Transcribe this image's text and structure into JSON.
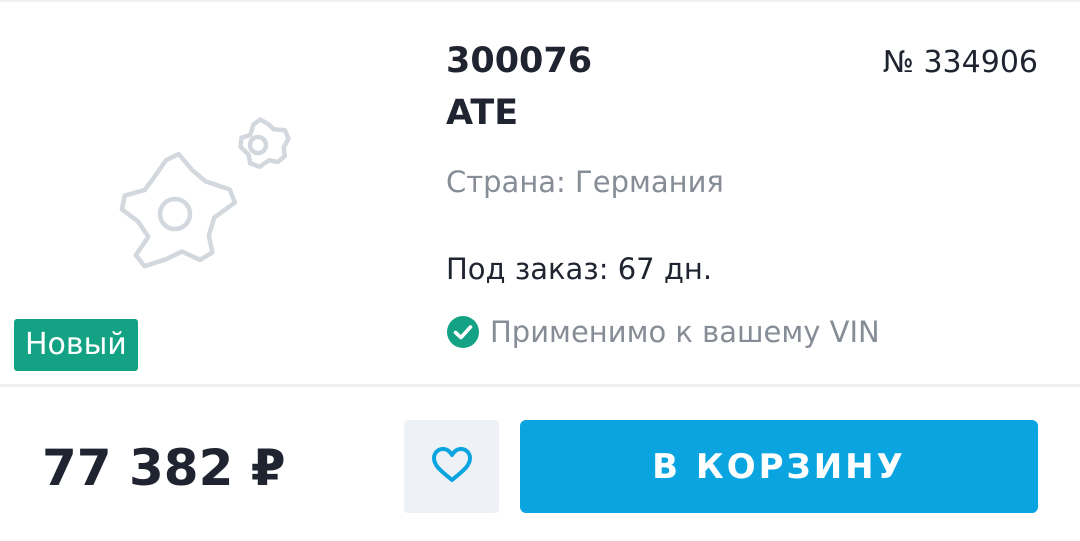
{
  "product": {
    "article": "300076",
    "brand": "ATE",
    "number": "№ 334906",
    "country": "Страна: Германия",
    "availability": "Под заказ: 67 дн.",
    "vin_match": "Применимо к вашему VIN",
    "badge": "Новый",
    "image_icon": "gears-placeholder-icon"
  },
  "footer": {
    "price": "77 382 ₽",
    "favorite_icon": "heart-icon",
    "cart_label": "В КОРЗИНУ"
  },
  "colors": {
    "badge": "#13a284",
    "check": "#13a284",
    "cart_button": "#0aa5e0",
    "favorite_bg": "#eef1f6",
    "favorite_icon": "#0aa5e0",
    "placeholder_icon": "#d3d8de",
    "text_primary": "#1f2430",
    "text_secondary": "#878d97"
  }
}
